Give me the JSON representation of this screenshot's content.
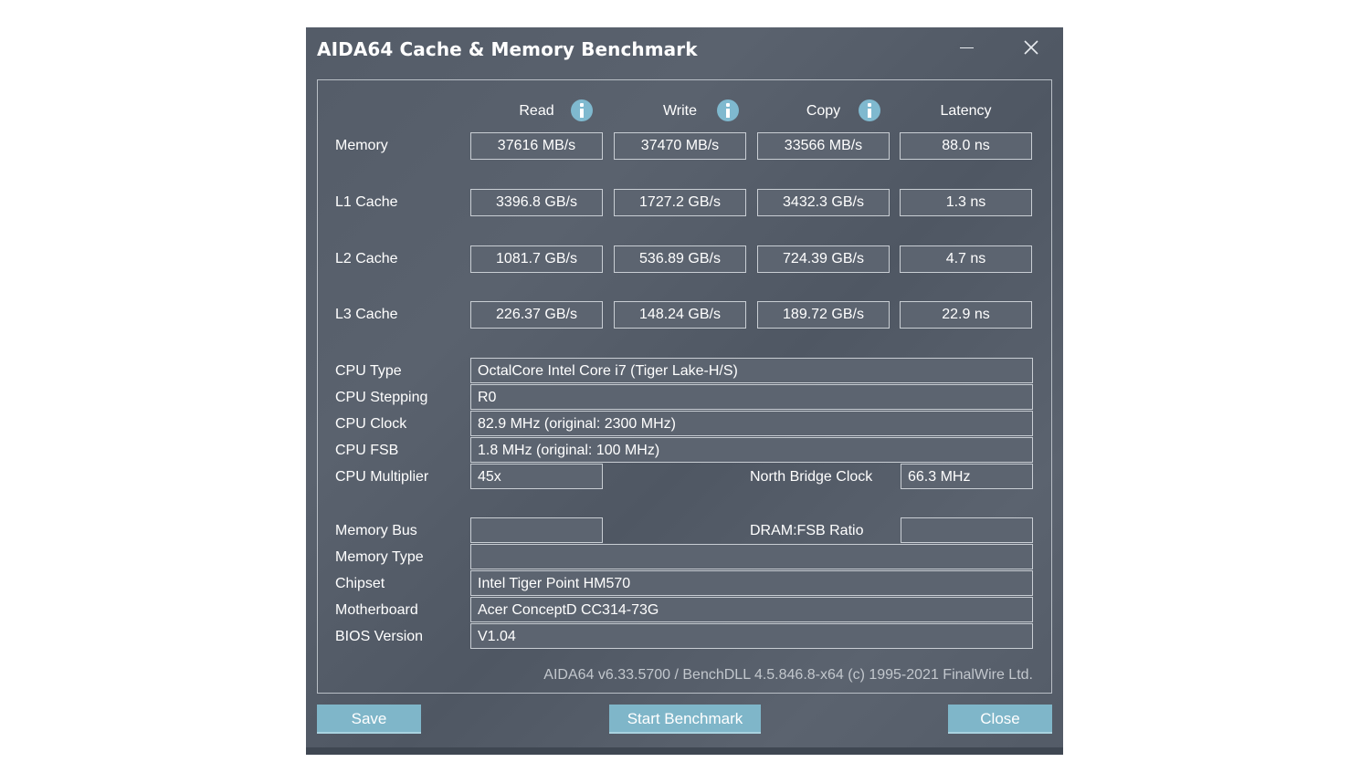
{
  "window": {
    "title": "AIDA64 Cache & Memory Benchmark"
  },
  "headers": {
    "read": "Read",
    "write": "Write",
    "copy": "Copy",
    "latency": "Latency"
  },
  "rows": [
    {
      "label": "Memory",
      "read": "37616 MB/s",
      "write": "37470 MB/s",
      "copy": "33566 MB/s",
      "latency": "88.0 ns"
    },
    {
      "label": "L1 Cache",
      "read": "3396.8 GB/s",
      "write": "1727.2 GB/s",
      "copy": "3432.3 GB/s",
      "latency": "1.3 ns"
    },
    {
      "label": "L2 Cache",
      "read": "1081.7 GB/s",
      "write": "536.89 GB/s",
      "copy": "724.39 GB/s",
      "latency": "4.7 ns"
    },
    {
      "label": "L3 Cache",
      "read": "226.37 GB/s",
      "write": "148.24 GB/s",
      "copy": "189.72 GB/s",
      "latency": "22.9 ns"
    }
  ],
  "info": {
    "cpu_type": {
      "label": "CPU Type",
      "value": "OctalCore Intel Core i7  (Tiger Lake-H/S)"
    },
    "cpu_stepping": {
      "label": "CPU Stepping",
      "value": "R0"
    },
    "cpu_clock": {
      "label": "CPU Clock",
      "value": "82.9 MHz  (original: 2300 MHz)"
    },
    "cpu_fsb": {
      "label": "CPU FSB",
      "value": "1.8 MHz  (original: 100 MHz)"
    },
    "cpu_multiplier": {
      "label": "CPU Multiplier",
      "value": "45x"
    },
    "north_bridge_clock": {
      "label": "North Bridge Clock",
      "value": "66.3 MHz"
    },
    "memory_bus": {
      "label": "Memory Bus",
      "value": ""
    },
    "dram_fsb_ratio": {
      "label": "DRAM:FSB Ratio",
      "value": ""
    },
    "memory_type": {
      "label": "Memory Type",
      "value": ""
    },
    "chipset": {
      "label": "Chipset",
      "value": "Intel Tiger Point HM570"
    },
    "motherboard": {
      "label": "Motherboard",
      "value": "Acer ConceptD CC314-73G"
    },
    "bios_version": {
      "label": "BIOS Version",
      "value": "V1.04"
    }
  },
  "footer": "AIDA64 v6.33.5700 / BenchDLL 4.5.846.8-x64  (c) 1995-2021 FinalWire Ltd.",
  "buttons": {
    "save": "Save",
    "start": "Start Benchmark",
    "close": "Close"
  },
  "icons": {
    "info": "info-icon",
    "minimize": "minimize-icon",
    "close": "close-icon"
  },
  "colors": {
    "window_bg": "#565e6a",
    "accent_button": "#7fb6c9",
    "info_icon": "#7fb9cf"
  }
}
